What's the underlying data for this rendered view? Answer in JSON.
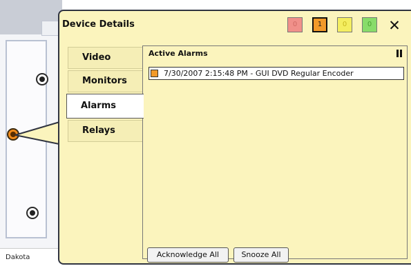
{
  "map": {
    "location_label": "Dakota"
  },
  "popup": {
    "title": "Device Details",
    "severity_counts": [
      {
        "name": "critical",
        "color": "#f0908a",
        "count": "0"
      },
      {
        "name": "high",
        "color": "#f29a2a",
        "count": "1",
        "selected": true
      },
      {
        "name": "medium",
        "color": "#f4ee60",
        "count": "0"
      },
      {
        "name": "low",
        "color": "#88dc6a",
        "count": "0"
      }
    ],
    "close_icon": "close-icon",
    "tabs": [
      {
        "label": "Video"
      },
      {
        "label": "Monitors"
      },
      {
        "label": "Alarms",
        "active": true
      },
      {
        "label": "Relays"
      }
    ],
    "active_alarms": {
      "title": "Active Alarms",
      "pause_icon": "pause-icon",
      "items": [
        {
          "text": "7/30/2007 2:15:48 PM - GUI DVD Regular Encoder",
          "color": "#f29a2a"
        }
      ]
    },
    "buttons": {
      "acknowledge_all": "Acknowledge All",
      "snooze_all": "Snooze All"
    }
  }
}
